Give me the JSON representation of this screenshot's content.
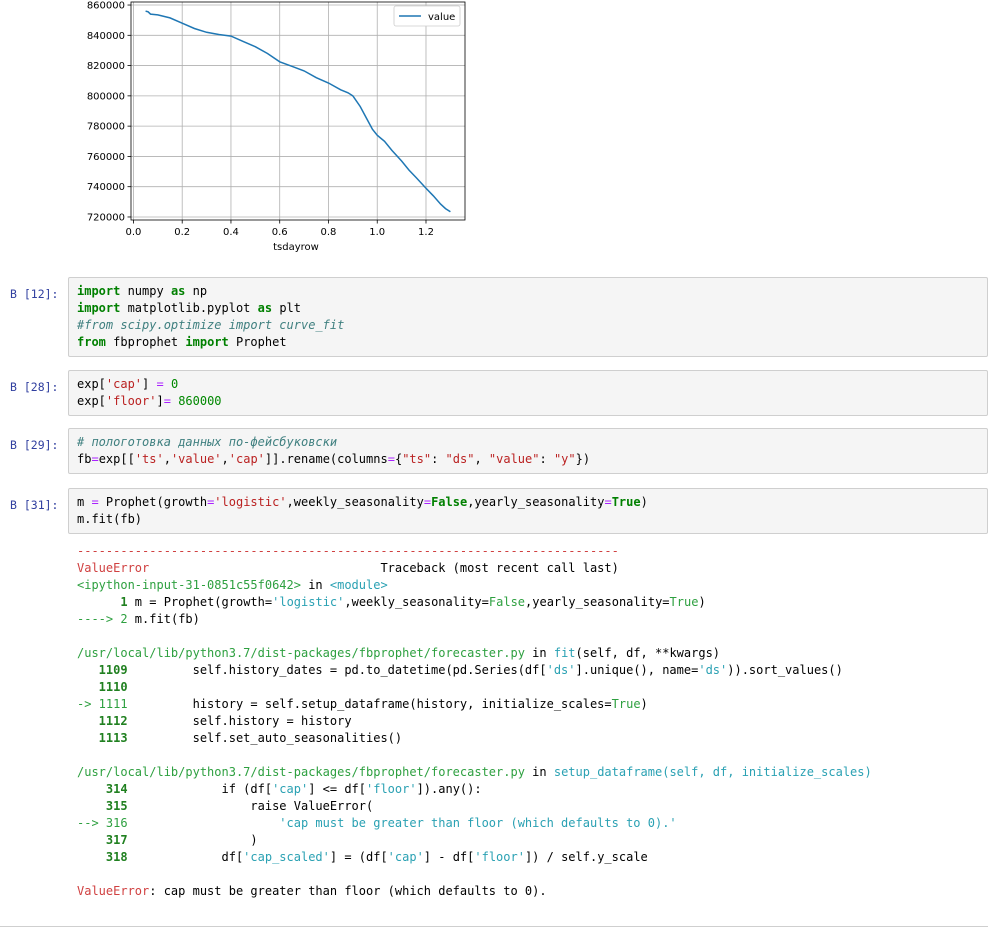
{
  "chart_data": {
    "type": "line",
    "xlabel": "tsdayrow",
    "ylabel": "",
    "xlim": [
      -0.01,
      1.36
    ],
    "ylim": [
      718000,
      862000
    ],
    "x_ticks": [
      "0.0",
      "0.2",
      "0.4",
      "0.6",
      "0.8",
      "1.0",
      "1.2"
    ],
    "x_tick_values": [
      0.0,
      0.2,
      0.4,
      0.6,
      0.8,
      1.0,
      1.2
    ],
    "y_ticks": [
      "720000",
      "740000",
      "760000",
      "780000",
      "800000",
      "820000",
      "840000",
      "860000"
    ],
    "y_tick_values": [
      720000,
      740000,
      760000,
      780000,
      800000,
      820000,
      840000,
      860000
    ],
    "grid": true,
    "legend": "top-right",
    "series": [
      {
        "name": "value",
        "color": "#1f77b4",
        "x": [
          0.05,
          0.06,
          0.07,
          0.1,
          0.15,
          0.2,
          0.25,
          0.3,
          0.35,
          0.4,
          0.45,
          0.5,
          0.55,
          0.6,
          0.65,
          0.7,
          0.75,
          0.8,
          0.85,
          0.88,
          0.9,
          0.93,
          0.96,
          0.98,
          1.0,
          1.03,
          1.06,
          1.1,
          1.13,
          1.16,
          1.2,
          1.23,
          1.26,
          1.28,
          1.3
        ],
        "values": [
          856000,
          855500,
          854000,
          853500,
          851500,
          848000,
          844500,
          842000,
          840500,
          839500,
          836000,
          832500,
          828000,
          822500,
          819500,
          816500,
          812000,
          808500,
          804000,
          802000,
          800000,
          793000,
          784000,
          778000,
          774000,
          770000,
          764000,
          757000,
          751000,
          746000,
          739000,
          734000,
          728500,
          725500,
          723500
        ]
      }
    ]
  },
  "cells": [
    {
      "prompt": "В [12]:",
      "lines": [
        [
          [
            "kw",
            "import"
          ],
          [
            "",
            " numpy "
          ],
          [
            "kw",
            "as"
          ],
          [
            "",
            " np"
          ]
        ],
        [
          [
            "kw",
            "import"
          ],
          [
            "",
            " matplotlib.pyplot "
          ],
          [
            "kw",
            "as"
          ],
          [
            "",
            " plt"
          ]
        ],
        [
          [
            "cm",
            "#from scipy.optimize import curve_fit"
          ]
        ],
        [
          [
            "kw",
            "from"
          ],
          [
            "",
            " fbprophet "
          ],
          [
            "kw",
            "import"
          ],
          [
            "",
            " Prophet"
          ]
        ]
      ]
    },
    {
      "prompt": "В [28]:",
      "lines": [
        [
          [
            "",
            "exp["
          ],
          [
            "st",
            "'cap'"
          ],
          [
            "",
            "] "
          ],
          [
            "eq",
            "="
          ],
          [
            "",
            " "
          ],
          [
            "nm",
            "0"
          ]
        ],
        [
          [
            "",
            "exp["
          ],
          [
            "st",
            "'floor'"
          ],
          [
            "",
            "]"
          ],
          [
            "eq",
            "="
          ],
          [
            "",
            " "
          ],
          [
            "nm",
            "860000"
          ]
        ]
      ]
    },
    {
      "prompt": "В [29]:",
      "lines": [
        [
          [
            "cm",
            "# пологотовка данных по-фейсбуковски"
          ]
        ],
        [
          [
            "",
            "fb"
          ],
          [
            "eq",
            "="
          ],
          [
            "",
            "exp[["
          ],
          [
            "st",
            "'ts'"
          ],
          [
            "",
            ","
          ],
          [
            "st",
            "'value'"
          ],
          [
            "",
            ","
          ],
          [
            "st",
            "'cap'"
          ],
          [
            "",
            "]].rename(columns"
          ],
          [
            "eq",
            "="
          ],
          [
            "",
            "{"
          ],
          [
            "st",
            "\"ts\""
          ],
          [
            "",
            ": "
          ],
          [
            "st",
            "\"ds\""
          ],
          [
            "",
            ", "
          ],
          [
            "st",
            "\"value\""
          ],
          [
            "",
            ": "
          ],
          [
            "st",
            "\"y\""
          ],
          [
            "",
            "})"
          ]
        ]
      ]
    },
    {
      "prompt": "В [31]:",
      "lines": [
        [
          [
            "",
            "m "
          ],
          [
            "eq",
            "="
          ],
          [
            "",
            " Prophet(growth"
          ],
          [
            "eq",
            "="
          ],
          [
            "st",
            "'logistic'"
          ],
          [
            "",
            ",weekly_seasonality"
          ],
          [
            "eq",
            "="
          ],
          [
            "kw",
            "False"
          ],
          [
            "",
            ",yearly_seasonality"
          ],
          [
            "eq",
            "="
          ],
          [
            "kw",
            "True"
          ],
          [
            "",
            ")"
          ]
        ],
        [
          [
            "",
            "m.fit(fb)"
          ]
        ]
      ]
    }
  ],
  "traceback": [
    [
      [
        "e-red",
        "---------------------------------------------------------------------------"
      ]
    ],
    [
      [
        "e-red",
        "ValueError"
      ],
      [
        "",
        "                                Traceback (most recent call last)"
      ]
    ],
    [
      [
        "e-green",
        "<ipython-input-31-0851c55f0642>"
      ],
      [
        "",
        " in "
      ],
      [
        "e-cyan",
        "<module>"
      ]
    ],
    [
      [
        "e-bold-green",
        "      1"
      ],
      [
        "",
        " m "
      ],
      [
        "",
        "="
      ],
      [
        "",
        " Prophet"
      ],
      [
        "",
        "("
      ],
      [
        "",
        "growth"
      ],
      [
        "",
        "="
      ],
      [
        "e-cyan",
        "'logistic'"
      ],
      [
        "",
        ","
      ],
      [
        "",
        "weekly_seasonality"
      ],
      [
        "",
        "="
      ],
      [
        "e-green",
        "False"
      ],
      [
        "",
        ","
      ],
      [
        "",
        "yearly_seasonality"
      ],
      [
        "",
        "="
      ],
      [
        "e-green",
        "True"
      ],
      [
        "",
        ")"
      ]
    ],
    [
      [
        "e-green",
        "----> 2"
      ],
      [
        "",
        " m"
      ],
      [
        "",
        "."
      ],
      [
        "",
        "fit"
      ],
      [
        "",
        "("
      ],
      [
        "",
        "fb"
      ],
      [
        "",
        ")"
      ]
    ],
    [
      [
        "",
        ""
      ]
    ],
    [
      [
        "e-green",
        "/usr/local/lib/python3.7/dist-packages/fbprophet/forecaster.py"
      ],
      [
        "",
        " in "
      ],
      [
        "e-cyan",
        "fit"
      ],
      [
        "",
        "(self, df, **kwargs)"
      ]
    ],
    [
      [
        "e-lineno",
        "   1109"
      ],
      [
        "",
        "         self.history_dates = pd.to_datetime(pd.Series(df["
      ],
      [
        "e-cyan",
        "'ds'"
      ],
      [
        "",
        "].unique(), name="
      ],
      [
        "e-cyan",
        "'ds'"
      ],
      [
        "",
        ")).sort_values()"
      ]
    ],
    [
      [
        "e-lineno",
        "   1110"
      ]
    ],
    [
      [
        "e-green",
        "-> 1111"
      ],
      [
        "",
        "         history = self.setup_dataframe(history, initialize_scales="
      ],
      [
        "e-green",
        "True"
      ],
      [
        "",
        ")"
      ]
    ],
    [
      [
        "e-lineno",
        "   1112"
      ],
      [
        "",
        "         self.history = history"
      ]
    ],
    [
      [
        "e-lineno",
        "   1113"
      ],
      [
        "",
        "         self.set_auto_seasonalities()"
      ]
    ],
    [
      [
        "",
        ""
      ]
    ],
    [
      [
        "e-green",
        "/usr/local/lib/python3.7/dist-packages/fbprophet/forecaster.py"
      ],
      [
        "",
        " in "
      ],
      [
        "e-cyan",
        "setup_dataframe"
      ],
      [
        "e-cyan",
        "(self, df, initialize_scales)"
      ]
    ],
    [
      [
        "e-lineno",
        "    314"
      ],
      [
        "",
        "             if (df["
      ],
      [
        "e-cyan",
        "'cap'"
      ],
      [
        "",
        "] <= df["
      ],
      [
        "e-cyan",
        "'floor'"
      ],
      [
        "",
        "]).any():"
      ]
    ],
    [
      [
        "e-lineno",
        "    315"
      ],
      [
        "",
        "                 raise ValueError("
      ]
    ],
    [
      [
        "e-green",
        "--> 316"
      ],
      [
        "",
        "                     "
      ],
      [
        "e-cyan",
        "'cap must be greater than floor (which defaults to 0).'"
      ]
    ],
    [
      [
        "e-lineno",
        "    317"
      ],
      [
        "",
        "                 )"
      ]
    ],
    [
      [
        "e-lineno",
        "    318"
      ],
      [
        "",
        "             df["
      ],
      [
        "e-cyan",
        "'cap_scaled'"
      ],
      [
        "",
        "] = (df["
      ],
      [
        "e-cyan",
        "'cap'"
      ],
      [
        "",
        "] - df["
      ],
      [
        "e-cyan",
        "'floor'"
      ],
      [
        "",
        "]) / self.y_scale"
      ]
    ],
    [
      [
        "",
        ""
      ]
    ],
    [
      [
        "e-red",
        "ValueError"
      ],
      [
        "",
        ": cap must be greater than floor (which defaults to 0)."
      ]
    ]
  ]
}
